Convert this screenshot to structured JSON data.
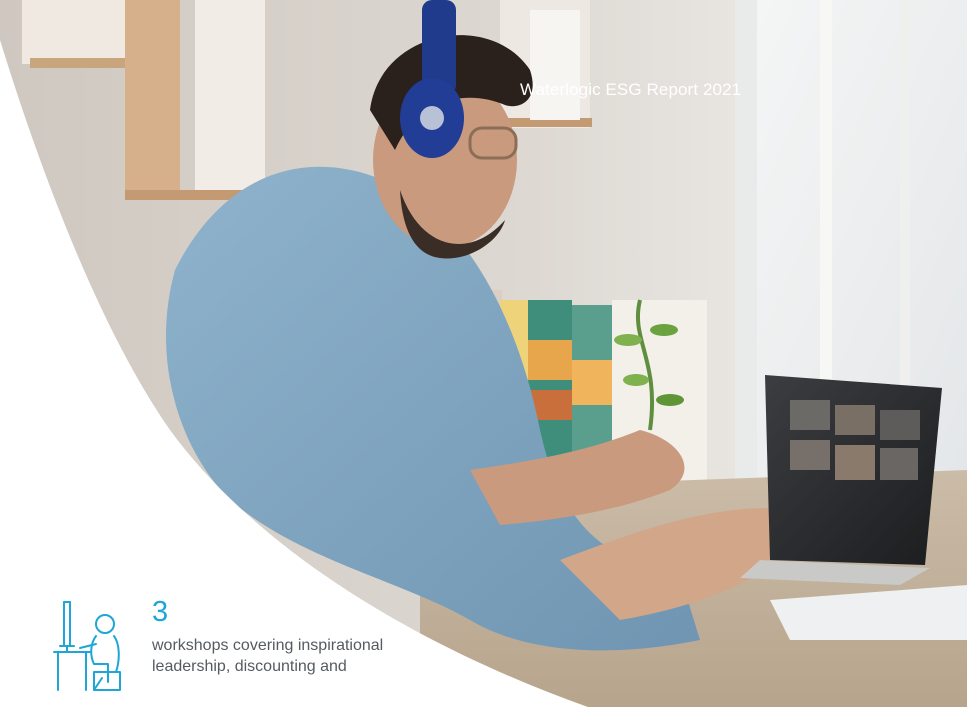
{
  "report": {
    "title": "Waterlogic ESG Report 2021"
  },
  "stat": {
    "number": "3",
    "description_lines": [
      "workshops covering inspirational",
      "leadership, discounting and"
    ]
  },
  "photo": {
    "subject": "man with headphones on a video call at a laptop"
  },
  "icons": {
    "stat_icon": "person-at-desk-icon"
  },
  "colors": {
    "accent": "#1ea6d6",
    "body_text": "#555b61",
    "background": "#ffffff",
    "title_text": "#ffffff"
  }
}
